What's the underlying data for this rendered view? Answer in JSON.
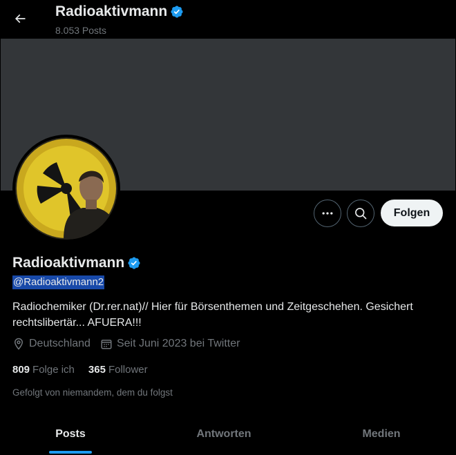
{
  "header": {
    "name": "Radioaktivmann",
    "posts_count": "8.053 Posts"
  },
  "profile": {
    "display_name": "Radioaktivmann",
    "handle": "@Radioaktivmann2",
    "bio": "Radiochemiker (Dr.rer.nat)// Hier für Börsenthemen und Zeitgeschehen. Gesichert rechtslibertär... AFUERA!!!",
    "location": "Deutschland",
    "joined": "Seit Juni 2023 bei Twitter",
    "following_count": "809",
    "following_label": "Folge ich",
    "followers_count": "365",
    "followers_label": "Follower",
    "followed_by": "Gefolgt von niemandem, dem du folgst",
    "verified": true
  },
  "actions": {
    "follow_label": "Folgen",
    "more_icon": "more-icon",
    "search_icon": "search-icon"
  },
  "tabs": [
    {
      "label": "Posts",
      "active": true
    },
    {
      "label": "Antworten",
      "active": false
    },
    {
      "label": "Medien",
      "active": false
    }
  ],
  "colors": {
    "accent": "#1d9bf0",
    "banner": "#333639",
    "background": "#000000",
    "follow_button": "#eff3f4"
  }
}
